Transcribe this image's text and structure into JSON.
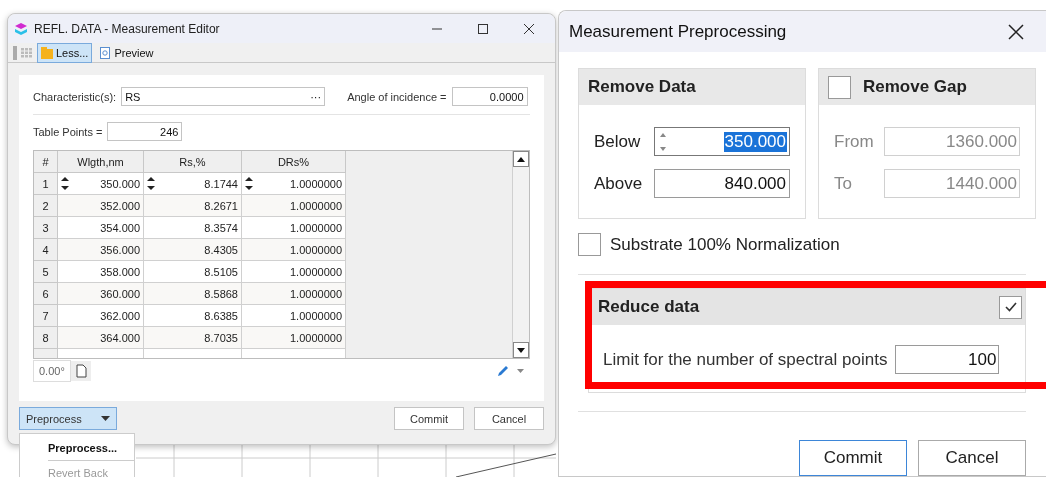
{
  "editor": {
    "title": "REFL. DATA - Measurement Editor",
    "toolbar": [
      {
        "label": "Less...",
        "selected": true
      },
      {
        "label": "Preview",
        "selected": false
      }
    ],
    "characteristics": {
      "label": "Characteristic(s):",
      "value": "RS",
      "button": "···"
    },
    "angle": {
      "label": "Angle of incidence =",
      "value": "0.0000"
    },
    "table_points": {
      "label": "Table Points =",
      "value": "246"
    },
    "table": {
      "columns": [
        "#",
        "Wlgth,nm",
        "Rs,%",
        "DRs%"
      ],
      "rows": [
        {
          "cells": [
            "1",
            "350.000",
            "8.1744",
            "1.0000000"
          ],
          "editing": true
        },
        {
          "cells": [
            "2",
            "352.000",
            "8.2671",
            "1.0000000"
          ],
          "editing": false
        },
        {
          "cells": [
            "3",
            "354.000",
            "8.3574",
            "1.0000000"
          ],
          "editing": false
        },
        {
          "cells": [
            "4",
            "356.000",
            "8.4305",
            "1.0000000"
          ],
          "editing": false
        },
        {
          "cells": [
            "5",
            "358.000",
            "8.5105",
            "1.0000000"
          ],
          "editing": false
        },
        {
          "cells": [
            "6",
            "360.000",
            "8.5868",
            "1.0000000"
          ],
          "editing": false
        },
        {
          "cells": [
            "7",
            "362.000",
            "8.6385",
            "1.0000000"
          ],
          "editing": false
        },
        {
          "cells": [
            "8",
            "364.000",
            "8.7035",
            "1.0000000"
          ],
          "editing": false
        }
      ]
    },
    "angle_chip": "0.00°",
    "preprocess": "Preprocess",
    "buttons": [
      "Commit",
      "Cancel"
    ],
    "menu": [
      {
        "label": "Preprocess...",
        "disabled": false
      },
      {
        "label": "Revert Back",
        "disabled": true
      }
    ]
  },
  "dialog": {
    "title": "Measurement Preprocessing",
    "remove_data": {
      "title": "Remove Data",
      "fields": [
        {
          "label": "Below",
          "value": "350.000",
          "focused": true
        },
        {
          "label": "Above",
          "value": "840.000",
          "focused": false
        }
      ]
    },
    "remove_gap": {
      "title": "Remove Gap",
      "checked": false,
      "fields": [
        {
          "label": "From",
          "value": "1360.000"
        },
        {
          "label": "To",
          "value": "1440.000"
        }
      ]
    },
    "substrate": {
      "label": "Substrate 100% Normalization",
      "checked": false
    },
    "reduce": {
      "title": "Reduce data",
      "checked": true,
      "highlighted": true,
      "limit_label": "Limit for the number of spectral points",
      "limit_value": "100"
    },
    "buttons": [
      {
        "label": "Commit",
        "default": true
      },
      {
        "label": "Cancel",
        "default": false
      }
    ]
  }
}
